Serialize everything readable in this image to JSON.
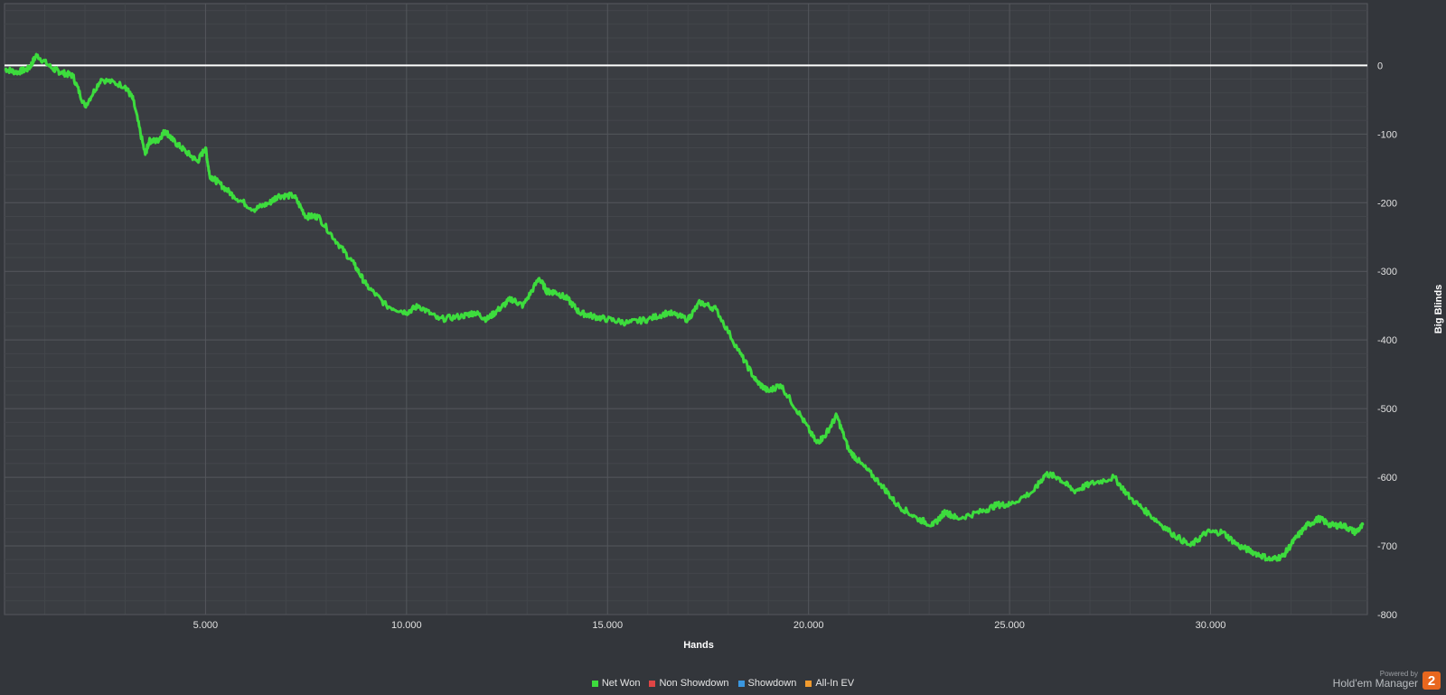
{
  "chart_data": {
    "type": "line",
    "xlabel": "Hands",
    "ylabel": "Big Blinds",
    "xlim": [
      0,
      33900
    ],
    "ylim": [
      -800,
      90
    ],
    "x_ticks": [
      5000,
      10000,
      15000,
      20000,
      25000,
      30000
    ],
    "x_tick_labels": [
      "5.000",
      "10.000",
      "15.000",
      "20.000",
      "25.000",
      "30.000"
    ],
    "y_ticks": [
      0,
      -100,
      -200,
      -300,
      -400,
      -500,
      -600,
      -700,
      -800
    ],
    "y_tick_labels": [
      "0",
      "-100",
      "-200",
      "-300",
      "-400",
      "-500",
      "-600",
      "-700",
      "-800"
    ],
    "grid": true,
    "legend_position": "bottom-center",
    "series": [
      {
        "name": "Net Won",
        "color": "#3ddc3d",
        "x": [
          0,
          300,
          600,
          800,
          1200,
          1400,
          1700,
          2000,
          2400,
          3000,
          3200,
          3500,
          3600,
          3800,
          4000,
          4200,
          4500,
          4800,
          5000,
          5100,
          5300,
          5700,
          6200,
          6600,
          6800,
          7200,
          7500,
          7800,
          8300,
          8700,
          9000,
          9500,
          10000,
          10300,
          10800,
          11400,
          11700,
          12000,
          12300,
          12600,
          12900,
          13300,
          13500,
          13700,
          14000,
          14300,
          14600,
          15000,
          15500,
          16000,
          16500,
          17000,
          17300,
          17700,
          18300,
          18700,
          19000,
          19300,
          19800,
          20200,
          20400,
          20700,
          21000,
          21300,
          21800,
          22200,
          22700,
          23100,
          23400,
          23700,
          24300,
          24700,
          25000,
          25600,
          25900,
          26200,
          26600,
          27000,
          27600,
          28000,
          28500,
          29000,
          29500,
          29900,
          30300,
          30700,
          31100,
          31500,
          31800,
          32100,
          32400,
          32700,
          33000,
          33300,
          33600,
          33800
        ],
        "y": [
          -5,
          -10,
          -5,
          15,
          -5,
          -10,
          -15,
          -60,
          -20,
          -30,
          -50,
          -130,
          -110,
          -110,
          -95,
          -110,
          -125,
          -140,
          -120,
          -160,
          -170,
          -190,
          -210,
          -200,
          -190,
          -190,
          -220,
          -220,
          -260,
          -290,
          -320,
          -350,
          -360,
          -350,
          -370,
          -365,
          -360,
          -370,
          -355,
          -340,
          -350,
          -310,
          -330,
          -330,
          -340,
          -360,
          -365,
          -370,
          -375,
          -370,
          -360,
          -370,
          -345,
          -355,
          -420,
          -460,
          -475,
          -465,
          -510,
          -550,
          -540,
          -510,
          -560,
          -580,
          -610,
          -640,
          -660,
          -670,
          -650,
          -660,
          -650,
          -640,
          -640,
          -620,
          -595,
          -600,
          -620,
          -610,
          -600,
          -630,
          -655,
          -680,
          -700,
          -680,
          -680,
          -700,
          -710,
          -720,
          -715,
          -690,
          -670,
          -660,
          -670,
          -670,
          -680,
          -670
        ]
      },
      {
        "name": "Non Showdown",
        "color": "#e04545",
        "x": [],
        "y": []
      },
      {
        "name": "Showdown",
        "color": "#3a97e0",
        "x": [],
        "y": []
      },
      {
        "name": "All-In EV",
        "color": "#f09a2e",
        "x": [],
        "y": []
      }
    ],
    "zero_line_color": "#ffffff"
  },
  "brand": {
    "powered_by": "Powered by",
    "name": "Hold'em Manager",
    "logo_text": "2",
    "logo_color": "#e8671e"
  }
}
